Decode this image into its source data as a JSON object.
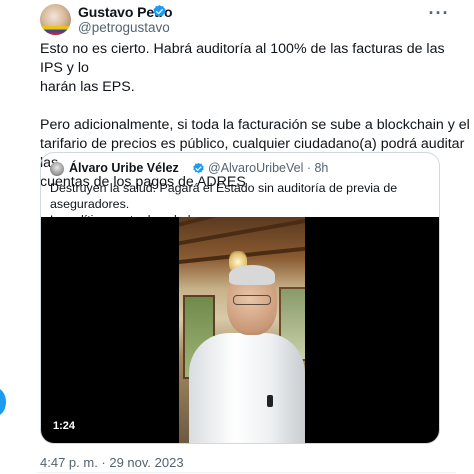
{
  "tweet": {
    "author_name": "Gustavo Petro",
    "author_handle": "@petrogustavo",
    "more_label": "···",
    "paragraphs": [
      "Esto no es cierto. Habrá auditoría al 100% de las facturas de las IPS y lo\nharán las EPS.",
      "Pero adicionalmente, si toda la facturación se sube a blockchain y el\ntarifario de precios es público, cualquier ciudadano(a) podrá auditar las\ncuentas de los pagos de ADRES"
    ],
    "timestamp": "4:47 p. m. · 29 nov. 2023"
  },
  "quote": {
    "author_name": "Álvaro Uribe Vélez",
    "author_handle_time": "@AlvaroUribeVel · 8h",
    "text": "Destruyen la salud. Pagará el Estado sin auditoría de previa de aseguradores.\nLa política contra la salud",
    "video_duration": "1:24"
  },
  "colors": {
    "verified": "#1d9bf0",
    "secondary_text": "#536471",
    "border": "#cfd9de"
  },
  "icons": {
    "verified": "verified-badge-icon",
    "more": "more-options-icon"
  }
}
